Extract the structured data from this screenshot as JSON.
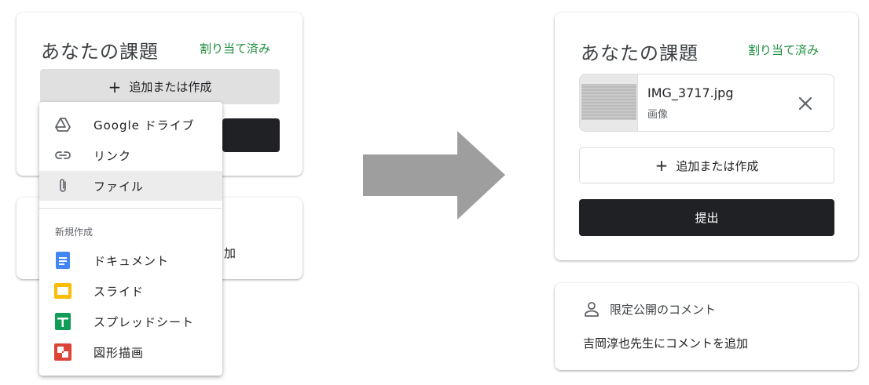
{
  "before": {
    "assignment_card": {
      "title": "あなたの課題",
      "status": "割り当て済み",
      "add_button": {
        "icon": "plus-icon",
        "label": "追加または作成"
      }
    },
    "comment_card": {
      "hint": "加"
    },
    "menu": {
      "items": [
        {
          "icon": "google-drive-icon",
          "label": "Google ドライブ"
        },
        {
          "icon": "link-icon",
          "label": "リンク"
        },
        {
          "icon": "paperclip-icon",
          "label": "ファイル",
          "highlighted": true
        }
      ],
      "section_label": "新規作成",
      "create_items": [
        {
          "icon": "docs-icon",
          "label": "ドキュメント",
          "color": "#4285f4"
        },
        {
          "icon": "slides-icon",
          "label": "スライド",
          "color": "#fbbc04"
        },
        {
          "icon": "sheets-icon",
          "label": "スプレッドシート",
          "color": "#0f9d58"
        },
        {
          "icon": "drawings-icon",
          "label": "図形描画",
          "color": "#db4437"
        }
      ]
    }
  },
  "after": {
    "assignment_card": {
      "title": "あなたの課題",
      "status": "割り当て済み",
      "attachment": {
        "file_name": "IMG_3717.jpg",
        "file_type": "画像"
      },
      "add_button": {
        "icon": "plus-icon",
        "label": "追加または作成"
      },
      "submit_label": "提出"
    },
    "comment_card": {
      "heading": "限定公開のコメント",
      "add_comment": "吉岡淳也先生にコメントを追加"
    }
  },
  "colors": {
    "status_green": "#1e8e3e",
    "submit_bg": "#202124",
    "arrow": "#9e9e9e"
  }
}
